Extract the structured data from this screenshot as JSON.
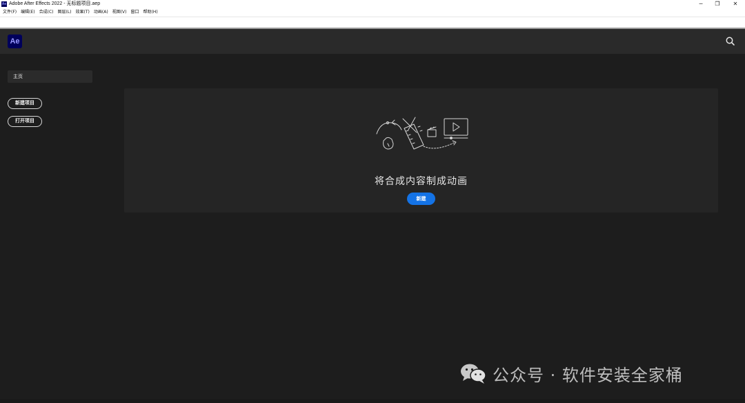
{
  "window": {
    "title": "Adobe After Effects 2022 - 无标题项目.aep",
    "app_icon_label": "Ae",
    "controls": {
      "minimize": "─",
      "maximize": "❐",
      "close": "✕"
    }
  },
  "menubar": {
    "items": [
      {
        "label": "文件(F)"
      },
      {
        "label": "编辑(E)"
      },
      {
        "label": "合成(C)"
      },
      {
        "label": "图层(L)"
      },
      {
        "label": "效果(T)"
      },
      {
        "label": "动画(A)"
      },
      {
        "label": "视图(V)"
      },
      {
        "label": "窗口"
      },
      {
        "label": "帮助(H)"
      }
    ]
  },
  "header": {
    "logo_label": "Ae",
    "search_icon": "search-icon"
  },
  "sidebar": {
    "home_label": "主页",
    "new_project_label": "新建项目",
    "open_project_label": "打开项目"
  },
  "hero": {
    "illustration_icon": "animation-illustration",
    "heading": "将合成内容制成动画",
    "new_button_label": "新建"
  },
  "watermark": {
    "icon": "wechat-icon",
    "text": "公众号 · 软件安装全家桶"
  },
  "colors": {
    "accent": "#1473e6",
    "ae_logo_bg": "#00005b",
    "ae_logo_fg": "#9999ff",
    "background": "#1d1d1d",
    "card": "#252525"
  }
}
